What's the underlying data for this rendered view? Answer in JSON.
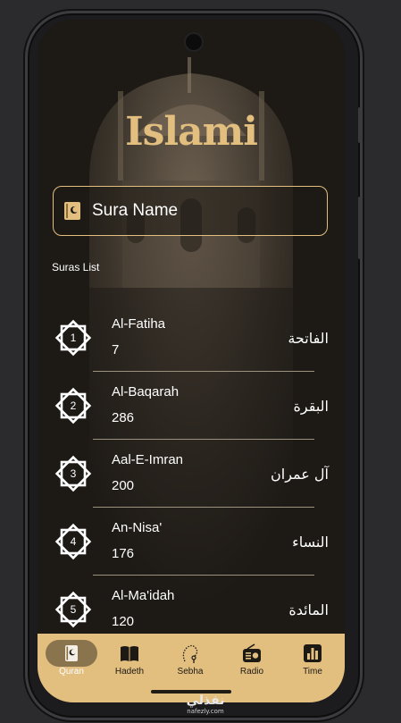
{
  "app": {
    "logo_text": "Islami"
  },
  "search": {
    "label": "Sura Name"
  },
  "section": {
    "title": "Suras List"
  },
  "suras": [
    {
      "number": "1",
      "name_en": "Al-Fatiha",
      "verses": "7",
      "name_ar": "الفاتحة"
    },
    {
      "number": "2",
      "name_en": "Al-Baqarah",
      "verses": "286",
      "name_ar": "البقرة"
    },
    {
      "number": "3",
      "name_en": "Aal-E-Imran",
      "verses": "200",
      "name_ar": "آل عمران"
    },
    {
      "number": "4",
      "name_en": "An-Nisa'",
      "verses": "176",
      "name_ar": "النساء"
    },
    {
      "number": "5",
      "name_en": "Al-Ma'idah",
      "verses": "120",
      "name_ar": "المائدة"
    }
  ],
  "nav": {
    "items": [
      {
        "label": "Quran",
        "icon": "quran-icon",
        "active": true
      },
      {
        "label": "Hadeth",
        "icon": "book-icon",
        "active": false
      },
      {
        "label": "Sebha",
        "icon": "sebha-icon",
        "active": false
      },
      {
        "label": "Radio",
        "icon": "radio-icon",
        "active": false
      },
      {
        "label": "Time",
        "icon": "chart-icon",
        "active": false
      }
    ]
  },
  "watermark": {
    "arabic": "نفذلي",
    "url": "nafezly.com"
  },
  "colors": {
    "accent": "#e2be7f",
    "background": "#1d1a16",
    "text": "#ffffff"
  }
}
